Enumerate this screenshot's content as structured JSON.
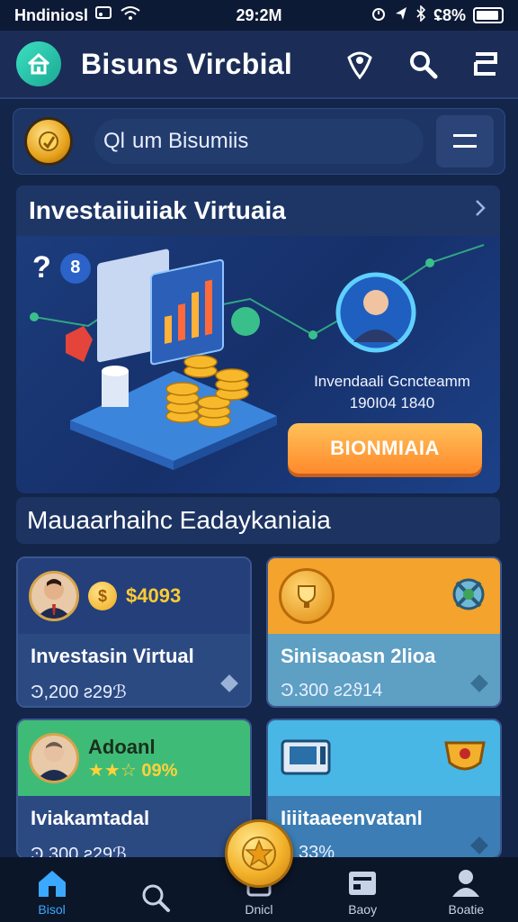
{
  "status_bar": {
    "carrier": "Hndiniosl",
    "time": "29:2M",
    "battery": "ʢ8%"
  },
  "header": {
    "title": "Bisuns Vircbial",
    "icons": [
      "location-pin-icon",
      "search-icon",
      "menu-e-icon"
    ]
  },
  "search": {
    "prefix": "Ql",
    "value": "um Bisumiis"
  },
  "section1": {
    "title": "Investaiiuiiak Virtuaia"
  },
  "banner": {
    "badges": [
      "?",
      "8"
    ],
    "caption_line1": "Invendaali Gcncteamm",
    "caption_line2": "190I04 1840",
    "button_label": "BIONMIAIA"
  },
  "section2": {
    "title": "Mauaarhaihc Eadaykaniaia"
  },
  "cards": [
    {
      "price": "$4093",
      "coin_glyph": "$",
      "title": "Investasin Virtual",
      "sub": "Ͽ,200 ƨ29ℬ",
      "colors": {
        "top": "#243f7a",
        "bottom": "#2c4a82"
      }
    },
    {
      "price": "",
      "title": "Sinisaoasn 2lioa",
      "sub": "Ͽ.300 ƨ2ϑ14",
      "colors": {
        "top": "#f4a32c",
        "bottom": "#5e9fc4"
      }
    },
    {
      "price": "★★☆ 09%",
      "name": "Adoanl",
      "title": "Iviakamtadal",
      "sub": "Ͽ 300 ƨ29ℬ",
      "colors": {
        "top": "#3fbb78",
        "bottom": "#2c4a82"
      }
    },
    {
      "price": "",
      "title": "Iiiitaaeenvatanl",
      "sub": "Ͽ 33%",
      "colors": {
        "top": "#49b7e6",
        "bottom": "#3b7db4"
      }
    }
  ],
  "bottom_nav": [
    {
      "label": "Bisol",
      "icon": "home-icon",
      "active": true
    },
    {
      "label": "",
      "icon": "search-icon",
      "active": false
    },
    {
      "label": "Dnicl",
      "icon": "coin-icon",
      "active": false
    },
    {
      "label": "Baoy",
      "icon": "wallet-icon",
      "active": false
    },
    {
      "label": "Boatie",
      "icon": "profile-icon",
      "active": false
    }
  ]
}
